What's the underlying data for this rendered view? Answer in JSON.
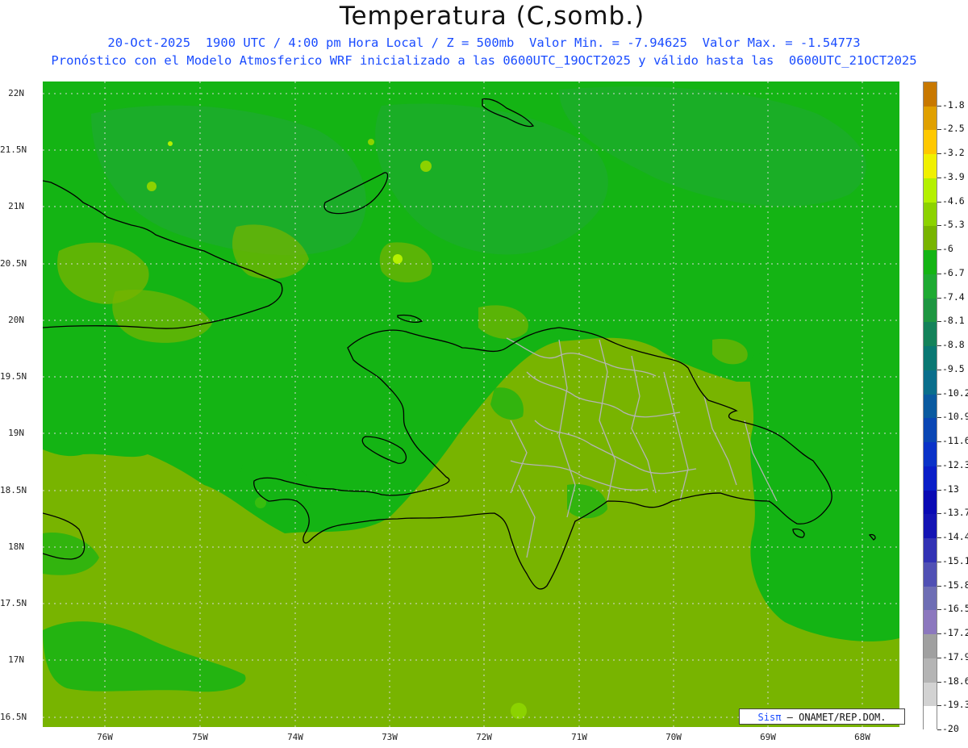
{
  "header": {
    "title": "Temperatura (C,somb.)",
    "line1": "20-Oct-2025  1900 UTC / 4:00 pm Hora Local / Z = 500mb  Valor Min. = -7.94625  Valor Max. = -1.54773",
    "line2": "Pronóstico con el Modelo Atmosferico WRF inicializado a las 0600UTC_19OCT2025 y válido hasta las  0600UTC_21OCT2025"
  },
  "axes": {
    "lat_labels": [
      "22N",
      "21.5N",
      "21N",
      "20.5N",
      "20N",
      "19.5N",
      "19N",
      "18.5N",
      "18N",
      "17.5N",
      "17N",
      "16.5N"
    ],
    "lon_labels": [
      "76W",
      "75W",
      "74W",
      "73W",
      "72W",
      "71W",
      "70W",
      "69W",
      "68W"
    ]
  },
  "legend": {
    "labels": [
      "-1.8",
      "-2.5",
      "-3.2",
      "-3.9",
      "-4.6",
      "-5.3",
      "-6",
      "-6.7",
      "-7.4",
      "-8.1",
      "-8.8",
      "-9.5",
      "-10.2",
      "-10.9",
      "-11.6",
      "-12.3",
      "-13",
      "-13.7",
      "-14.4",
      "-15.1",
      "-15.8",
      "-16.5",
      "-17.2",
      "-17.9",
      "-18.6",
      "-19.3",
      "-20"
    ],
    "colors": [
      "#c87800",
      "#e0a000",
      "#ffc800",
      "#f0f000",
      "#b4f000",
      "#8cd200",
      "#78b400",
      "#14b414",
      "#1eaa32",
      "#1e9641",
      "#14825a",
      "#0a7873",
      "#0a6e8c",
      "#0a5aa0",
      "#0a46b4",
      "#0a32c8",
      "#0a1ec8",
      "#0a0ab4",
      "#1414b4",
      "#3232b4",
      "#5050b4",
      "#6e6eb4",
      "#8c78be",
      "#a0a0a0",
      "#b4b4b4",
      "#d2d2d2",
      "#ffffff"
    ]
  },
  "credit": {
    "sis": "Sisπ",
    "org": "– ONAMET/REP.DOM."
  },
  "colors": {
    "land_green": "#78b400",
    "sea_green": "#14b414",
    "coast": "#000000",
    "provinces": "#b4b4b4",
    "text_blue": "#1a4cff"
  }
}
